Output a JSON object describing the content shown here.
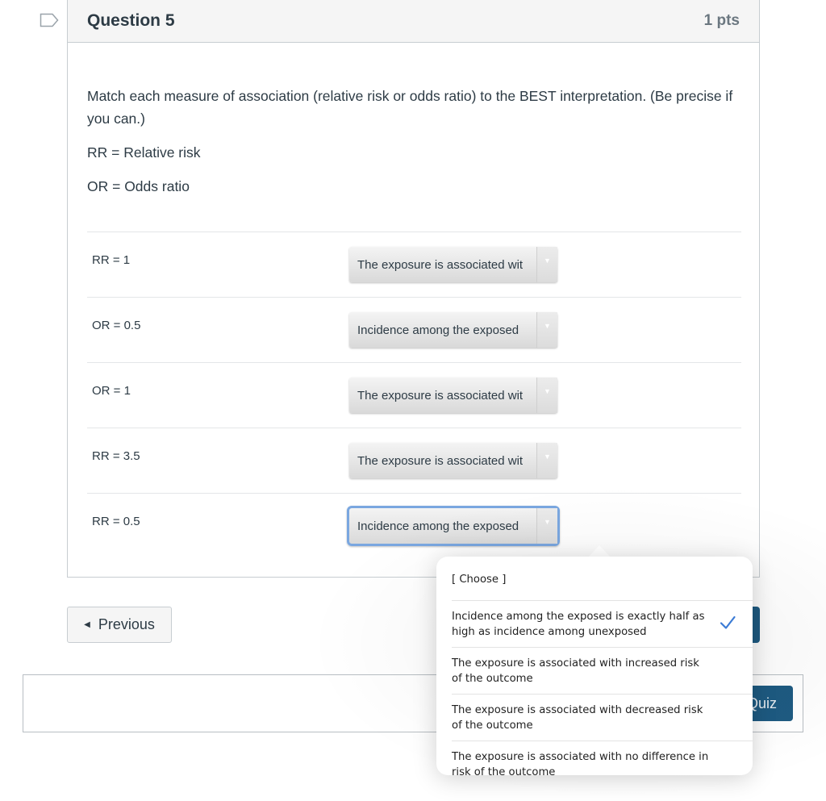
{
  "question": {
    "title": "Question 5",
    "points": "1 pts",
    "prompt": "Match each measure of association (relative risk or odds ratio)  to the BEST interpretation. (Be precise if you can.)",
    "legend": [
      "RR = Relative risk",
      "OR = Odds ratio"
    ]
  },
  "answers": [
    {
      "label": "RR = 1",
      "selected": "The exposure is associated wit"
    },
    {
      "label": "OR = 0.5",
      "selected": "Incidence among the exposed"
    },
    {
      "label": "OR = 1",
      "selected": "The exposure is associated wit"
    },
    {
      "label": "RR = 3.5",
      "selected": "The exposure is associated wit"
    },
    {
      "label": "RR = 0.5",
      "selected": "Incidence among the exposed"
    }
  ],
  "dropdown": {
    "options": [
      {
        "label": "[ Choose ]",
        "checked": false
      },
      {
        "label": "Incidence among the exposed is exactly half as high as incidence among unexposed",
        "checked": true
      },
      {
        "label": "The exposure is associated with increased risk of the outcome",
        "checked": false
      },
      {
        "label": "The exposure is associated with decreased risk of the outcome",
        "checked": false
      },
      {
        "label": "The exposure is associated with no difference in risk of the outcome",
        "checked": false
      }
    ]
  },
  "nav": {
    "previous_label": "Previous",
    "submit_label": "Quiz"
  },
  "colors": {
    "accent": "#1e5b82",
    "focus": "#7aa7e0",
    "check": "#3b7bd5"
  }
}
